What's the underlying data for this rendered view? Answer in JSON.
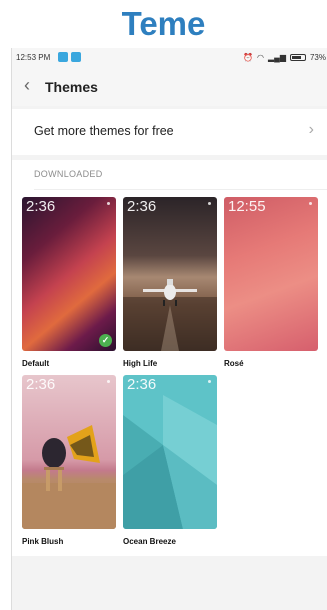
{
  "banner": {
    "title": "Teme"
  },
  "statusbar": {
    "time": "12:53 PM",
    "battery": "73%",
    "battery_level": 0.73
  },
  "appbar": {
    "back_icon": "chevron-left-icon",
    "title": "Themes"
  },
  "promo": {
    "label": "Get more themes for free",
    "chevron_icon": "chevron-right-icon"
  },
  "section": {
    "header": "DOWNLOADED"
  },
  "themes": [
    {
      "name": "Default",
      "clock": "2:36",
      "selected": true
    },
    {
      "name": "High Life",
      "clock": "2:36",
      "selected": false
    },
    {
      "name": "Rosé",
      "clock": "12:55",
      "selected": false
    },
    {
      "name": "Pink Blush",
      "clock": "2:36",
      "selected": false
    },
    {
      "name": "Ocean Breeze",
      "clock": "2:36",
      "selected": false
    }
  ],
  "colors": {
    "banner": "#2e7fbf",
    "check": "#4cb050",
    "accent": "#3aa7de"
  }
}
